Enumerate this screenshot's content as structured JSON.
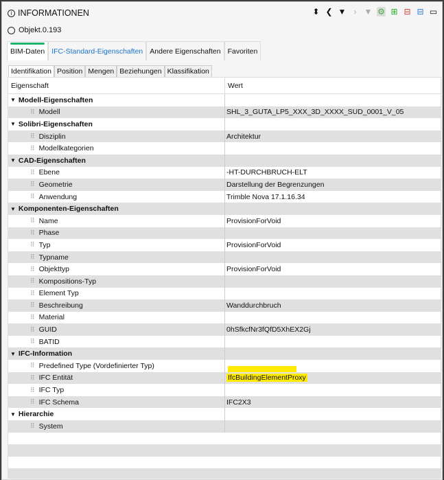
{
  "header": {
    "title": "INFORMATIONEN",
    "object": "Objekt.0.193"
  },
  "toolbar": [
    "sort-icon",
    "chevron-left-icon",
    "triangle-down-icon",
    "chevron-right-icon",
    "triangle-down-disabled-icon",
    "model-green-icon",
    "clipboard-add-icon",
    "clipboard-remove-icon",
    "clipboard-blue-icon",
    "window-icon"
  ],
  "tabs": [
    "BIM-Daten",
    "IFC-Standard-Eigenschaften",
    "Andere Eigenschaften",
    "Favoriten"
  ],
  "subtabs": [
    "Identifikation",
    "Position",
    "Mengen",
    "Beziehungen",
    "Klassifikation"
  ],
  "table": {
    "col1": "Eigenschaft",
    "col2": "Wert",
    "rows": [
      {
        "type": "group",
        "name": "Modell-Eigenschaften",
        "value": ""
      },
      {
        "type": "leaf",
        "name": "Modell",
        "value": "SHL_3_GUTA_LP5_XXX_3D_XXXX_SUD_0001_V_05"
      },
      {
        "type": "group",
        "name": "Solibri-Eigenschaften",
        "value": ""
      },
      {
        "type": "leaf",
        "name": "Disziplin",
        "value": "Architektur"
      },
      {
        "type": "leaf",
        "name": "Modellkategorien",
        "value": ""
      },
      {
        "type": "group",
        "name": "CAD-Eigenschaften",
        "value": ""
      },
      {
        "type": "leaf",
        "name": "Ebene",
        "value": "-HT-DURCHBRUCH-ELT"
      },
      {
        "type": "leaf",
        "name": "Geometrie",
        "value": "Darstellung der Begrenzungen"
      },
      {
        "type": "leaf",
        "name": "Anwendung",
        "value": "Trimble Nova 17.1.16.34"
      },
      {
        "type": "group",
        "name": "Komponenten-Eigenschaften",
        "value": ""
      },
      {
        "type": "leaf",
        "name": "Name",
        "value": "ProvisionForVoid"
      },
      {
        "type": "leaf",
        "name": "Phase",
        "value": ""
      },
      {
        "type": "leaf",
        "name": "Typ",
        "value": "ProvisionForVoid"
      },
      {
        "type": "leaf",
        "name": "Typname",
        "value": ""
      },
      {
        "type": "leaf",
        "name": "Objekttyp",
        "value": "ProvisionForVoid"
      },
      {
        "type": "leaf",
        "name": "Kompositions-Typ",
        "value": ""
      },
      {
        "type": "leaf",
        "name": "Element Typ",
        "value": ""
      },
      {
        "type": "leaf",
        "name": "Beschreibung",
        "value": "Wanddurchbruch"
      },
      {
        "type": "leaf",
        "name": "Material",
        "value": ""
      },
      {
        "type": "leaf",
        "name": "GUID",
        "value": "0hSfkcfNr3fQfD5XhEX2Gj"
      },
      {
        "type": "leaf",
        "name": "BATID",
        "value": ""
      },
      {
        "type": "group",
        "name": "IFC-Information",
        "value": ""
      },
      {
        "type": "leaf",
        "name": "Predefined Type (Vordefinierter Typ)",
        "value": "",
        "highlight": "box"
      },
      {
        "type": "leaf",
        "name": "IFC Entität",
        "value": "IfcBuildingElementProxy",
        "highlight": "text"
      },
      {
        "type": "leaf",
        "name": "IFC Typ",
        "value": ""
      },
      {
        "type": "leaf",
        "name": "IFC Schema",
        "value": "IFC2X3"
      },
      {
        "type": "group",
        "name": "Hierarchie",
        "value": ""
      },
      {
        "type": "leaf",
        "name": "System",
        "value": ""
      }
    ]
  }
}
